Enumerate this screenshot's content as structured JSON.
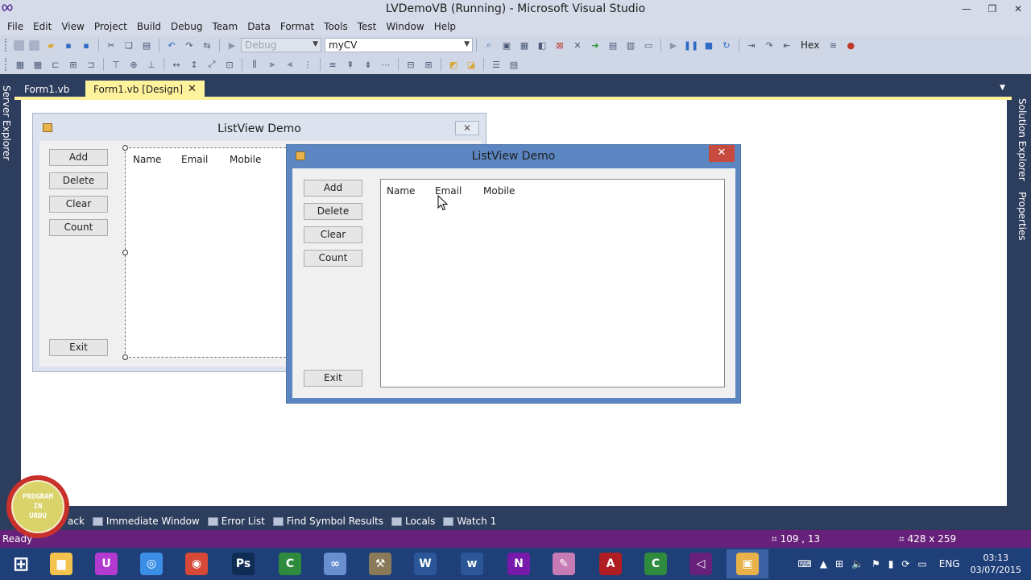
{
  "window": {
    "title": "LVDemoVB (Running) - Microsoft Visual Studio",
    "logo_icon": "infinity-icon",
    "buttons": [
      "minimize-icon",
      "restore-icon",
      "close-icon"
    ]
  },
  "menu": [
    "File",
    "Edit",
    "View",
    "Project",
    "Build",
    "Debug",
    "Team",
    "Data",
    "Format",
    "Tools",
    "Test",
    "Window",
    "Help"
  ],
  "toolbar": {
    "config_combo": "Debug",
    "startup_combo": "myCV",
    "hex_label": "Hex"
  },
  "side_panels": {
    "left": "Server Explorer",
    "right_top": "Solution Explorer",
    "right_bottom": "Properties"
  },
  "doc_tabs": [
    {
      "label": "Form1.vb",
      "active": false
    },
    {
      "label": "Form1.vb [Design]",
      "active": true,
      "close": "✕"
    }
  ],
  "designer_form": {
    "title": "ListView Demo",
    "buttons": [
      "Add",
      "Delete",
      "Clear",
      "Count"
    ],
    "exit_button": "Exit",
    "columns": [
      "Name",
      "Email",
      "Mobile"
    ],
    "close": "✕"
  },
  "running_form": {
    "title": "ListView Demo",
    "buttons": [
      "Add",
      "Delete",
      "Clear",
      "Count"
    ],
    "exit_button": "Exit",
    "columns": [
      "Name",
      "Email",
      "Mobile"
    ],
    "close": "✕"
  },
  "bottom_tabs": [
    "ack",
    "Immediate Window",
    "Error List",
    "Find Symbol Results",
    "Locals",
    "Watch 1"
  ],
  "status": {
    "text": "Ready",
    "position": "109 , 13",
    "size": "428 x 259"
  },
  "badge": {
    "line1": "PROGRAM",
    "line2": "IN",
    "line3": "URDU"
  },
  "taskbar": {
    "apps": [
      {
        "name": "start-icon",
        "color": "#ffffff",
        "glyph": "⊞"
      },
      {
        "name": "file-explorer-icon",
        "color": "#f2c14e",
        "glyph": "▆"
      },
      {
        "name": "ultraedit-icon",
        "color": "#b33ad1",
        "glyph": "U"
      },
      {
        "name": "browser-compass-icon",
        "color": "#3a8ee6",
        "glyph": "◎"
      },
      {
        "name": "chrome-icon",
        "color": "#d64937",
        "glyph": "◉"
      },
      {
        "name": "photoshop-icon",
        "color": "#0f2c55",
        "glyph": "Ps"
      },
      {
        "name": "camtasia-icon",
        "color": "#2e8b3e",
        "glyph": "C"
      },
      {
        "name": "vs-loop-icon",
        "color": "#6a8fd0",
        "glyph": "∞"
      },
      {
        "name": "tools-icon",
        "color": "#8a7a5a",
        "glyph": "⚒"
      },
      {
        "name": "word-icon",
        "color": "#2b579a",
        "glyph": "W"
      },
      {
        "name": "wordpad-icon",
        "color": "#2b579a",
        "glyph": "w"
      },
      {
        "name": "onenote-icon",
        "color": "#7719aa",
        "glyph": "N"
      },
      {
        "name": "paint-icon",
        "color": "#c77bb5",
        "glyph": "✎"
      },
      {
        "name": "acrobat-icon",
        "color": "#b01e23",
        "glyph": "A"
      },
      {
        "name": "camtasia-recorder-icon",
        "color": "#2e8b3e",
        "glyph": "C"
      },
      {
        "name": "visual-studio-icon",
        "color": "#68217a",
        "glyph": "◁"
      },
      {
        "name": "running-form-icon",
        "color": "#e8b14a",
        "glyph": "▣"
      }
    ],
    "lang": "ENG",
    "time": "03:13",
    "date": "03/07/2015"
  }
}
